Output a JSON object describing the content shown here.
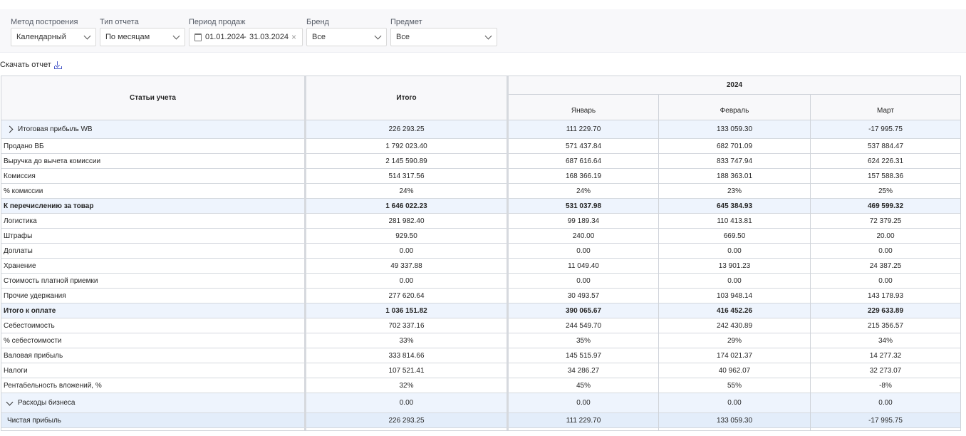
{
  "filters": {
    "method": {
      "label": "Метод построения",
      "value": "Календарный"
    },
    "report_type": {
      "label": "Тип отчета",
      "value": "По месяцам"
    },
    "period": {
      "label": "Период продаж",
      "from": "01.01.2024",
      "sep": "-",
      "to": "31.03.2024",
      "clear": "×"
    },
    "brand": {
      "label": "Бренд",
      "value": "Все"
    },
    "subject": {
      "label": "Предмет",
      "value": "Все"
    }
  },
  "download_label": "Скачать отчет",
  "table": {
    "headers": {
      "items": "Статьи учета",
      "total": "Итого",
      "year": "2024",
      "months": [
        "Январь",
        "Февраль",
        "Март"
      ]
    },
    "rows": [
      {
        "label": "Итоговая прибыль WB",
        "values": [
          "226 293.25",
          "111 229.70",
          "133 059.30",
          "-17 995.75"
        ]
      },
      {
        "label": "Продано ВБ",
        "values": [
          "1 792 023.40",
          "571 437.84",
          "682 701.09",
          "537 884.47"
        ]
      },
      {
        "label": "Выручка до вычета комиссии",
        "values": [
          "2 145 590.89",
          "687 616.64",
          "833 747.94",
          "624 226.31"
        ]
      },
      {
        "label": "Комиссия",
        "values": [
          "514 317.56",
          "168 366.19",
          "188 363.01",
          "157 588.36"
        ]
      },
      {
        "label": "% комиссии",
        "values": [
          "24%",
          "24%",
          "23%",
          "25%"
        ]
      },
      {
        "label": "К перечислению за товар",
        "values": [
          "1 646 022.23",
          "531 037.98",
          "645 384.93",
          "469 599.32"
        ]
      },
      {
        "label": "Логистика",
        "values": [
          "281 982.40",
          "99 189.34",
          "110 413.81",
          "72 379.25"
        ]
      },
      {
        "label": "Штрафы",
        "values": [
          "929.50",
          "240.00",
          "669.50",
          "20.00"
        ]
      },
      {
        "label": "Доплаты",
        "values": [
          "0.00",
          "0.00",
          "0.00",
          "0.00"
        ]
      },
      {
        "label": "Хранение",
        "values": [
          "49 337.88",
          "11 049.40",
          "13 901.23",
          "24 387.25"
        ]
      },
      {
        "label": "Стоимость платной приемки",
        "values": [
          "0.00",
          "0.00",
          "0.00",
          "0.00"
        ]
      },
      {
        "label": "Прочие удержания",
        "values": [
          "277 620.64",
          "30 493.57",
          "103 948.14",
          "143 178.93"
        ]
      },
      {
        "label": "Итого к оплате",
        "values": [
          "1 036 151.82",
          "390 065.67",
          "416 452.26",
          "229 633.89"
        ]
      },
      {
        "label": "Себестоимость",
        "values": [
          "702 337.16",
          "244 549.70",
          "242 430.89",
          "215 356.57"
        ]
      },
      {
        "label": "% себестоимости",
        "values": [
          "33%",
          "35%",
          "29%",
          "34%"
        ]
      },
      {
        "label": "Валовая прибыль",
        "values": [
          "333 814.66",
          "145 515.97",
          "174 021.37",
          "14 277.32"
        ]
      },
      {
        "label": "Налоги",
        "values": [
          "107 521.41",
          "34 286.27",
          "40 962.07",
          "32 273.07"
        ]
      },
      {
        "label": "Рентабельность вложений, %",
        "values": [
          "32%",
          "45%",
          "55%",
          "-8%"
        ]
      },
      {
        "label": "Расходы бизнеса",
        "values": [
          "0.00",
          "0.00",
          "0.00",
          "0.00"
        ]
      },
      {
        "label": "Чистая прибыль",
        "values": [
          "226 293.25",
          "111 229.70",
          "133 059.30",
          "-17 995.75"
        ]
      }
    ]
  }
}
